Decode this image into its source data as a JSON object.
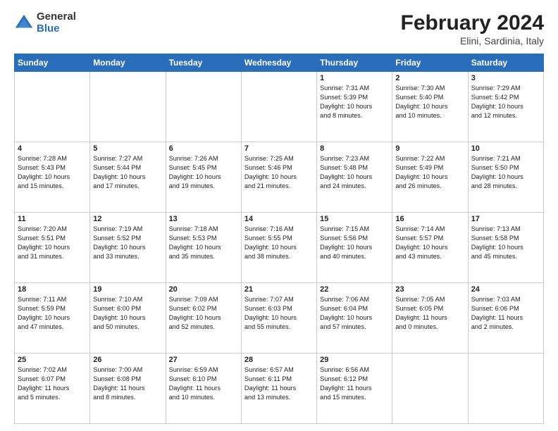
{
  "logo": {
    "general": "General",
    "blue": "Blue"
  },
  "title": {
    "month_year": "February 2024",
    "location": "Elini, Sardinia, Italy"
  },
  "weekdays": [
    "Sunday",
    "Monday",
    "Tuesday",
    "Wednesday",
    "Thursday",
    "Friday",
    "Saturday"
  ],
  "weeks": [
    [
      {
        "day": "",
        "info": ""
      },
      {
        "day": "",
        "info": ""
      },
      {
        "day": "",
        "info": ""
      },
      {
        "day": "",
        "info": ""
      },
      {
        "day": "1",
        "info": "Sunrise: 7:31 AM\nSunset: 5:39 PM\nDaylight: 10 hours\nand 8 minutes."
      },
      {
        "day": "2",
        "info": "Sunrise: 7:30 AM\nSunset: 5:40 PM\nDaylight: 10 hours\nand 10 minutes."
      },
      {
        "day": "3",
        "info": "Sunrise: 7:29 AM\nSunset: 5:42 PM\nDaylight: 10 hours\nand 12 minutes."
      }
    ],
    [
      {
        "day": "4",
        "info": "Sunrise: 7:28 AM\nSunset: 5:43 PM\nDaylight: 10 hours\nand 15 minutes."
      },
      {
        "day": "5",
        "info": "Sunrise: 7:27 AM\nSunset: 5:44 PM\nDaylight: 10 hours\nand 17 minutes."
      },
      {
        "day": "6",
        "info": "Sunrise: 7:26 AM\nSunset: 5:45 PM\nDaylight: 10 hours\nand 19 minutes."
      },
      {
        "day": "7",
        "info": "Sunrise: 7:25 AM\nSunset: 5:46 PM\nDaylight: 10 hours\nand 21 minutes."
      },
      {
        "day": "8",
        "info": "Sunrise: 7:23 AM\nSunset: 5:48 PM\nDaylight: 10 hours\nand 24 minutes."
      },
      {
        "day": "9",
        "info": "Sunrise: 7:22 AM\nSunset: 5:49 PM\nDaylight: 10 hours\nand 26 minutes."
      },
      {
        "day": "10",
        "info": "Sunrise: 7:21 AM\nSunset: 5:50 PM\nDaylight: 10 hours\nand 28 minutes."
      }
    ],
    [
      {
        "day": "11",
        "info": "Sunrise: 7:20 AM\nSunset: 5:51 PM\nDaylight: 10 hours\nand 31 minutes."
      },
      {
        "day": "12",
        "info": "Sunrise: 7:19 AM\nSunset: 5:52 PM\nDaylight: 10 hours\nand 33 minutes."
      },
      {
        "day": "13",
        "info": "Sunrise: 7:18 AM\nSunset: 5:53 PM\nDaylight: 10 hours\nand 35 minutes."
      },
      {
        "day": "14",
        "info": "Sunrise: 7:16 AM\nSunset: 5:55 PM\nDaylight: 10 hours\nand 38 minutes."
      },
      {
        "day": "15",
        "info": "Sunrise: 7:15 AM\nSunset: 5:56 PM\nDaylight: 10 hours\nand 40 minutes."
      },
      {
        "day": "16",
        "info": "Sunrise: 7:14 AM\nSunset: 5:57 PM\nDaylight: 10 hours\nand 43 minutes."
      },
      {
        "day": "17",
        "info": "Sunrise: 7:13 AM\nSunset: 5:58 PM\nDaylight: 10 hours\nand 45 minutes."
      }
    ],
    [
      {
        "day": "18",
        "info": "Sunrise: 7:11 AM\nSunset: 5:59 PM\nDaylight: 10 hours\nand 47 minutes."
      },
      {
        "day": "19",
        "info": "Sunrise: 7:10 AM\nSunset: 6:00 PM\nDaylight: 10 hours\nand 50 minutes."
      },
      {
        "day": "20",
        "info": "Sunrise: 7:09 AM\nSunset: 6:02 PM\nDaylight: 10 hours\nand 52 minutes."
      },
      {
        "day": "21",
        "info": "Sunrise: 7:07 AM\nSunset: 6:03 PM\nDaylight: 10 hours\nand 55 minutes."
      },
      {
        "day": "22",
        "info": "Sunrise: 7:06 AM\nSunset: 6:04 PM\nDaylight: 10 hours\nand 57 minutes."
      },
      {
        "day": "23",
        "info": "Sunrise: 7:05 AM\nSunset: 6:05 PM\nDaylight: 11 hours\nand 0 minutes."
      },
      {
        "day": "24",
        "info": "Sunrise: 7:03 AM\nSunset: 6:06 PM\nDaylight: 11 hours\nand 2 minutes."
      }
    ],
    [
      {
        "day": "25",
        "info": "Sunrise: 7:02 AM\nSunset: 6:07 PM\nDaylight: 11 hours\nand 5 minutes."
      },
      {
        "day": "26",
        "info": "Sunrise: 7:00 AM\nSunset: 6:08 PM\nDaylight: 11 hours\nand 8 minutes."
      },
      {
        "day": "27",
        "info": "Sunrise: 6:59 AM\nSunset: 6:10 PM\nDaylight: 11 hours\nand 10 minutes."
      },
      {
        "day": "28",
        "info": "Sunrise: 6:57 AM\nSunset: 6:11 PM\nDaylight: 11 hours\nand 13 minutes."
      },
      {
        "day": "29",
        "info": "Sunrise: 6:56 AM\nSunset: 6:12 PM\nDaylight: 11 hours\nand 15 minutes."
      },
      {
        "day": "",
        "info": ""
      },
      {
        "day": "",
        "info": ""
      }
    ]
  ]
}
